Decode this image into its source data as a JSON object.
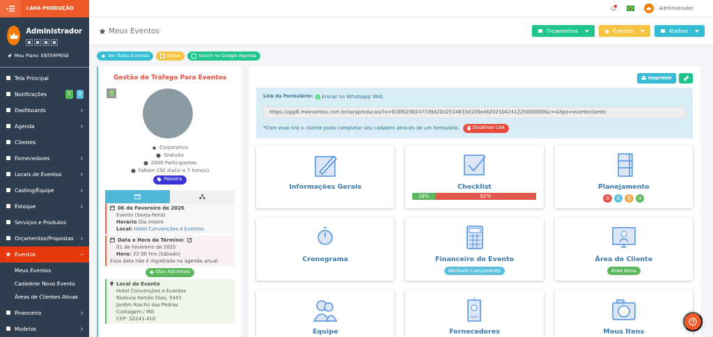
{
  "topbar": {
    "brand": "LARA PRODUÇÃO",
    "user": "Administrador"
  },
  "sidebar": {
    "user_name": "Administrador",
    "plan": "Meu Plano: ENTERPRISE",
    "items": [
      {
        "label": "Tela Principal",
        "selected": false,
        "has_submenu": false
      },
      {
        "label": "Notificações",
        "selected": false,
        "has_submenu": false,
        "badges": [
          {
            "text": "7",
            "color": "#5cb85c"
          },
          {
            "text": "0",
            "color": "#5bc0de"
          }
        ]
      },
      {
        "label": "Dashboards",
        "selected": false,
        "has_submenu": true
      },
      {
        "label": "Agenda",
        "selected": false,
        "has_submenu": true
      },
      {
        "label": "Clientes",
        "selected": false,
        "has_submenu": false
      },
      {
        "label": "Fornecedores",
        "selected": false,
        "has_submenu": true
      },
      {
        "label": "Locais de Eventos",
        "selected": false,
        "has_submenu": true
      },
      {
        "label": "Casting/Equipe",
        "selected": false,
        "has_submenu": true
      },
      {
        "label": "Estoque",
        "selected": false,
        "has_submenu": true
      },
      {
        "label": "Serviços e Produtos",
        "selected": false,
        "has_submenu": false
      },
      {
        "label": "Orçamentos/Propostas",
        "selected": false,
        "has_submenu": true
      },
      {
        "label": "Eventos",
        "selected": true,
        "has_submenu": true,
        "expanded": true,
        "children": [
          {
            "label": "Meus Eventos"
          },
          {
            "label": "Cadastrar Novo Evento"
          },
          {
            "label": "Áreas de Clientes Ativas"
          }
        ]
      },
      {
        "label": "Financeiro",
        "selected": false,
        "has_submenu": true
      },
      {
        "label": "Modelos",
        "selected": false,
        "has_submenu": true
      }
    ]
  },
  "header": {
    "title": "Meus Eventos",
    "buttons": [
      {
        "label": "Orçamentos",
        "color": "#1fc58a"
      },
      {
        "label": "Eventos",
        "color": "#f6c343"
      },
      {
        "label": "Atalhos",
        "color": "#36bcd2"
      }
    ]
  },
  "actions": [
    {
      "label": "Ver Todos Eventos",
      "color": "#36bcd2"
    },
    {
      "label": "Editar",
      "color": "#f6c343"
    },
    {
      "label": "Inserir no Google Agenda",
      "color": "#1fc58a"
    }
  ],
  "event": {
    "title": "Gestão de Tráfego Para Eventos",
    "info": [
      "Corporativo",
      "Gratuito",
      "2000 Participantes",
      "Faltam 192 dia(s) e 7 hora(s)"
    ],
    "tag": "Palestra",
    "tabs": [
      {
        "selected": true
      },
      {
        "selected": false
      }
    ],
    "start": {
      "date": "06 de Fevereiro de 2026",
      "weekday": "Evento (Sexta-feira)",
      "time_label": "Horário",
      "time": "Dia inteiro",
      "place_label": "Local:",
      "place": "Hotel Convenções e Eventos"
    },
    "end": {
      "title": "Data e Hora de Término:",
      "date": "01 de Fevereiro de 2025",
      "time_label": "Hora:",
      "time": "22:00 Hrs",
      "weekday": "(Sábado)",
      "note": "Essa data não é registrada na agenda anual."
    },
    "extra_days_button": "Dias Adicionais",
    "location": {
      "title": "Local do Evento",
      "lines": [
        "Hotel Convenções e Eventos",
        "Rodovia Fernão Dias, 3443",
        "Jardim Riacho das Pedras",
        "Contagem / MG",
        "CEP: 32241-410"
      ]
    }
  },
  "panel": {
    "print_button": "Imprimir",
    "form_link": {
      "label": "Link da Formulário:",
      "whatsapp": "Enviar no Whatsapp Web",
      "url": "https://app6.meeventos.com.br/laraproducao/?x=916f0290247749d20d2534633d109e46202504241225000000&c=&tipo=eventocliente",
      "note": "*Com esse link o cliente pode completar seu cadastro através de um formulário.",
      "disable_button": "Desativar Link"
    },
    "tiles": [
      {
        "title": "Informações Gerais",
        "kind": "plain"
      },
      {
        "title": "Checklist",
        "kind": "progress",
        "level": 0.18,
        "done_label": "18%",
        "todo_label": "82%"
      },
      {
        "title": "Planejamento",
        "kind": "counters",
        "counters": [
          {
            "text": "0",
            "color": "#e2574c"
          },
          {
            "text": "0",
            "color": "#5bc0de"
          },
          {
            "text": "0",
            "color": "#f0ad4e"
          },
          {
            "text": "0",
            "color": "#5cb85c"
          }
        ]
      },
      {
        "title": "Cronograma",
        "kind": "plain"
      },
      {
        "title": "Financeiro do Evento",
        "kind": "badge",
        "badge": {
          "text": "Nenhum Lançamento",
          "color": "#5bc0de"
        }
      },
      {
        "title": "Área do Cliente",
        "kind": "badge",
        "badge": {
          "text": "Área Ativa",
          "color": "#5cb85c"
        }
      },
      {
        "title": "Equipe",
        "kind": "plain"
      },
      {
        "title": "Fornecedores",
        "kind": "plain"
      },
      {
        "title": "Meus Itens",
        "kind": "plain"
      }
    ]
  }
}
